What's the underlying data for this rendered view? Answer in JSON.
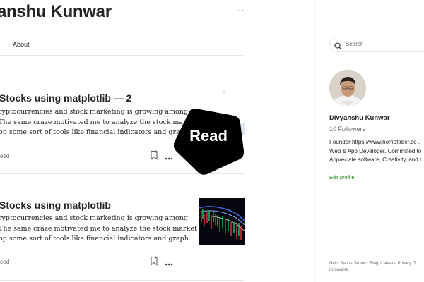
{
  "profile": {
    "title": "anshu Kunwar",
    "tabs": [
      "About"
    ],
    "more_label": "···"
  },
  "posts": [
    {
      "title": "Stocks using matplotlib — 2",
      "excerpt": [
        "ryptocurrencies and stock marketing is growing among",
        "The same craze motivated me to analyze the stock market",
        "op some sort of tools like financial indicators and graph. …"
      ],
      "read_time": "ead",
      "has_thumbnail": false
    },
    {
      "title": "Stocks using matplotlib",
      "excerpt": [
        "ryptocurrencies and stock marketing is growing among",
        "The same craze motivated me to analyze the stock market",
        "op some sort of tools like financial indicators and graph. …"
      ],
      "read_time": "ead",
      "has_thumbnail": true
    }
  ],
  "read_overlay": {
    "label": "Read"
  },
  "sidebar": {
    "search_placeholder": "Search",
    "author_name": "Divyanshu Kunwar",
    "followers": "10 Followers",
    "bio": {
      "line1_prefix": "Founder ",
      "line1_link": "https://www.homofaber.co",
      "line1_suffix": " .",
      "line2": "Web & App Developer. Committed to",
      "line3": "Appreciate software, Creativity, and t"
    },
    "edit_profile": "Edit profile",
    "footer_links": [
      "Help",
      "Status",
      "Writers",
      "Blog",
      "Careers",
      "Privacy",
      "T",
      "Knowable"
    ]
  },
  "colors": {
    "accent_green": "#1a8917",
    "text": "#242424",
    "muted": "#6b6b6b"
  }
}
